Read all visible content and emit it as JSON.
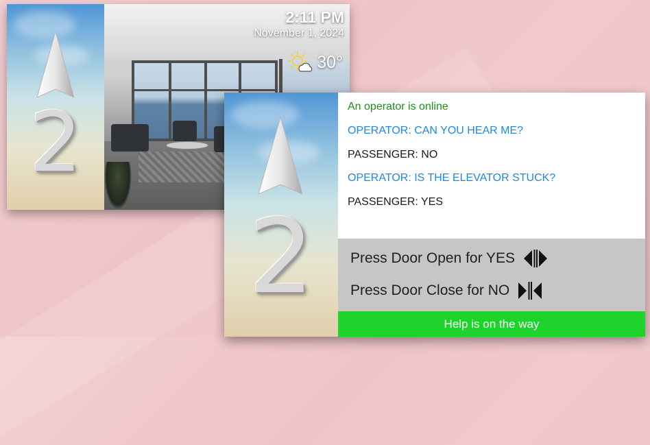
{
  "lobby_screen": {
    "floor": "2",
    "time": "2:11 PM",
    "date": "November 1, 2024",
    "weather": {
      "icon": "partly-sunny-icon",
      "temperature": "30°"
    }
  },
  "emergency_screen": {
    "floor": "2",
    "chat": [
      {
        "text": "An operator is online",
        "color": "#1a8f1a"
      },
      {
        "text": "OPERATOR: CAN YOU HEAR ME?",
        "color": "#1e88e5"
      },
      {
        "text": "PASSENGER: NO",
        "color": "#1a1a1a"
      },
      {
        "text": "OPERATOR: IS THE ELEVATOR STUCK?",
        "color": "#1e88e5"
      },
      {
        "text": "PASSENGER: YES",
        "color": "#1a1a1a"
      }
    ],
    "prompts": [
      {
        "label": "Press Door Open for YES",
        "icon": "door-open-icon"
      },
      {
        "label": "Press Door Close for NO",
        "icon": "door-close-icon"
      }
    ],
    "status": "Help is on the way",
    "status_color": "#1ed32c"
  }
}
